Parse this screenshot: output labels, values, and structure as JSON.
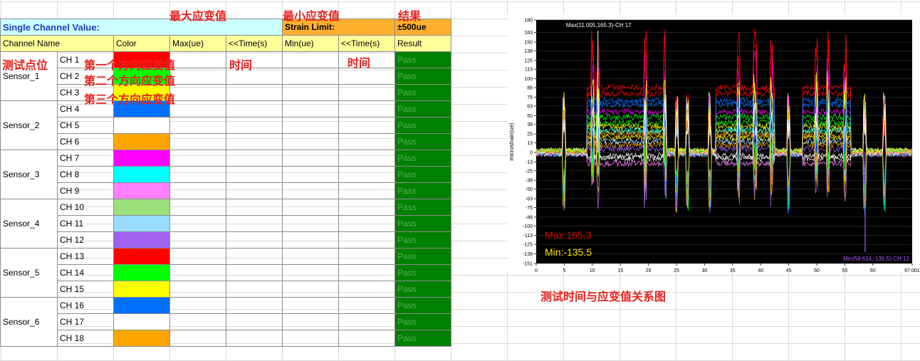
{
  "annotations": {
    "max_strain": "最大应变值",
    "min_strain": "最小应变值",
    "result": "结果",
    "test_point": "测试点位",
    "dir1": "第一个方向应变值",
    "dir2": "第二个方向应变值",
    "dir3": "第三个方向应变值",
    "time1": "时间",
    "time2": "时间",
    "chart_caption": "测试时间与应变值关系图"
  },
  "table": {
    "single_channel_value": "Single Channel Value:",
    "strain_limit": "Strain Limit:",
    "limit_value": "±500ue",
    "headers": [
      "Channel Name",
      "Color",
      "Max(ue)",
      "<<Time(s)",
      "Min(ue)",
      "<<Time(s)",
      "Result"
    ],
    "sensors": [
      "Sensor_1",
      "Sensor_2",
      "Sensor_3",
      "Sensor_4",
      "Sensor_5",
      "Sensor_6"
    ],
    "channels": [
      {
        "name": "CH 1",
        "color": "#ff0000",
        "result": "Pass"
      },
      {
        "name": "CH 2",
        "color": "#00ff00",
        "result": "Pass"
      },
      {
        "name": "CH 3",
        "color": "#ffff00",
        "result": "Pass"
      },
      {
        "name": "CH 4",
        "color": "#0070ff",
        "result": "Pass"
      },
      {
        "name": "CH 5",
        "color": "#ffffff",
        "result": "Pass"
      },
      {
        "name": "CH 6",
        "color": "#ffa500",
        "result": "Pass"
      },
      {
        "name": "CH 7",
        "color": "#ff00ff",
        "result": "Pass"
      },
      {
        "name": "CH 8",
        "color": "#00ffff",
        "result": "Pass"
      },
      {
        "name": "CH 9",
        "color": "#ff80ff",
        "result": "Pass"
      },
      {
        "name": "CH 10",
        "color": "#99e07a",
        "result": "Pass"
      },
      {
        "name": "CH 11",
        "color": "#99dcff",
        "result": "Pass"
      },
      {
        "name": "CH 12",
        "color": "#a060f0",
        "result": "Pass"
      },
      {
        "name": "CH 13",
        "color": "#ff0000",
        "result": "Pass"
      },
      {
        "name": "CH 14",
        "color": "#00ff00",
        "result": "Pass"
      },
      {
        "name": "CH 15",
        "color": "#ffff00",
        "result": "Pass"
      },
      {
        "name": "CH 16",
        "color": "#0070ff",
        "result": "Pass"
      },
      {
        "name": "CH 17",
        "color": "#ffffff",
        "result": "Pass"
      },
      {
        "name": "CH 18",
        "color": "#ffa500",
        "result": "Pass"
      }
    ]
  },
  "chart_data": {
    "type": "line",
    "ylabel": "microstrain(ue)",
    "xlim": [
      0,
      67.001
    ],
    "ylim": [
      -151,
      180
    ],
    "x_ticks": [
      "0",
      "5",
      "10",
      "15",
      "20",
      "25",
      "30",
      "35",
      "40",
      "45",
      "50",
      "55",
      "60",
      "67.001"
    ],
    "x_tick_values": [
      0,
      5,
      10,
      15,
      20,
      25,
      30,
      35,
      40,
      45,
      50,
      55,
      60,
      67.001
    ],
    "y_ticks": [
      "180",
      "163",
      "150",
      "138",
      "125",
      "113",
      "100",
      "88",
      "75",
      "63",
      "50",
      "38",
      "25",
      "13",
      "0",
      "-13",
      "-25",
      "-38",
      "-50",
      "-63",
      "-75",
      "-88",
      "-100",
      "-113",
      "-125",
      "-138",
      "-151"
    ],
    "y_tick_values": [
      180,
      163,
      150,
      138,
      125,
      113,
      100,
      88,
      75,
      63,
      50,
      38,
      25,
      13,
      0,
      -13,
      -25,
      -38,
      -50,
      -63,
      -75,
      -88,
      -100,
      -113,
      -125,
      -138,
      -151
    ],
    "max_annotation": "Max(11.005,165.3)-CH 17",
    "min_annotation": "Min(58.614,-135.5)-CH 12",
    "max_label": "Max:165.3",
    "min_label": "Min:-135.5",
    "max_point": {
      "x": 11.005,
      "y": 165.3
    },
    "min_point": {
      "x": 58.614,
      "y": -135.5
    },
    "plateaus": [
      [
        9,
        23
      ],
      [
        32,
        42.5
      ],
      [
        47.5,
        56
      ]
    ],
    "channel_levels": [
      88,
      40,
      20,
      65,
      -8,
      10,
      55,
      30,
      -15,
      28,
      15,
      5,
      80,
      48,
      35,
      70,
      -5,
      24
    ]
  }
}
